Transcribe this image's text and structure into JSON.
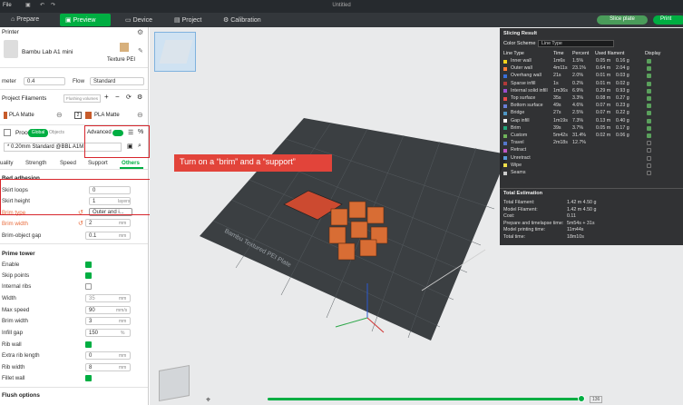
{
  "window": {
    "title": "Untitled",
    "file_menu": "File"
  },
  "tabs": [
    "Prepare",
    "Preview",
    "Device",
    "Project",
    "Calibration"
  ],
  "actions": {
    "slice_plate": "Slice plate",
    "print": "Print"
  },
  "printer": {
    "section": "Printer",
    "name": "Bambu Lab A1 mini",
    "plate": "Texture PEI"
  },
  "nozzle": {
    "diameter_label": "meter",
    "diameter": "0.4",
    "flow_label": "Flow",
    "flow": "Standard"
  },
  "filaments": {
    "section": "Project Filaments",
    "flushing": "Flushing volumes",
    "items": [
      {
        "num": "1",
        "name": "PLA Matte"
      },
      {
        "num": "2",
        "name": "PLA Matte"
      }
    ]
  },
  "process": {
    "section": "Process",
    "global": "Global",
    "objects": "Objects",
    "advanced": "Advanced",
    "profile": "* 0.20mm Standard @BBL A1M"
  },
  "process_tabs": [
    "uality",
    "Strength",
    "Speed",
    "Support",
    "Others"
  ],
  "bed_adhesion": {
    "section": "Bed adhesion",
    "skirt_loops": {
      "label": "Skirt loops",
      "value": "0"
    },
    "skirt_height": {
      "label": "Skirt height",
      "value": "1",
      "unit": "layers"
    },
    "brim_type": {
      "label": "Brim type",
      "value": "Outer and i..."
    },
    "brim_width": {
      "label": "Brim width",
      "value": "2",
      "unit": "mm"
    },
    "brim_gap": {
      "label": "Brim-object gap",
      "value": "0.1",
      "unit": "mm"
    }
  },
  "prime_tower": {
    "section": "Prime tower",
    "enable": "Enable",
    "skip_points": "Skip points",
    "internal_ribs": "Internal ribs",
    "width": {
      "label": "Width",
      "value": "35",
      "unit": "mm"
    },
    "max_speed": {
      "label": "Max speed",
      "value": "90",
      "unit": "mm/s"
    },
    "brim_width": {
      "label": "Brim width",
      "value": "3",
      "unit": "mm"
    },
    "infill_gap": {
      "label": "Infill gap",
      "value": "150",
      "unit": "%"
    },
    "rib_wall": "Rib wall",
    "extra_rib_length": {
      "label": "Extra rib length",
      "value": "0",
      "unit": "mm"
    },
    "rib_width": {
      "label": "Rib width",
      "value": "8",
      "unit": "mm"
    },
    "fillet_wall": "Fillet wall"
  },
  "flush_options": {
    "section": "Flush options"
  },
  "callout": "Turn on a “brim” and a “support”",
  "plate_label": "Bambu Textured PEI Plate",
  "slicing": {
    "title": "Slicing Result",
    "scheme_label": "Color Scheme",
    "scheme": "Line Type",
    "cols": [
      "Line Type",
      "Time",
      "Percent",
      "Used filament",
      "Display"
    ],
    "rows": [
      {
        "name": "Inner wall",
        "time": "1m6s",
        "pct": "1.5%",
        "len": "0.05 m",
        "wt": "0.16 g",
        "color": "#f2d21b",
        "check": true
      },
      {
        "name": "Outer wall",
        "time": "4m11s",
        "pct": "23.1%",
        "len": "0.64 m",
        "wt": "2.04 g",
        "color": "#ff7d38",
        "check": true
      },
      {
        "name": "Overhang wall",
        "time": "21s",
        "pct": "2.0%",
        "len": "0.01 m",
        "wt": "0.03 g",
        "color": "#3a6fd8",
        "check": true
      },
      {
        "name": "Sparse infill",
        "time": "1s",
        "pct": "0.2%",
        "len": "0.01 m",
        "wt": "0.02 g",
        "color": "#b13a3a",
        "check": true
      },
      {
        "name": "Internal solid infill",
        "time": "1m36s",
        "pct": "6.9%",
        "len": "0.29 m",
        "wt": "0.93 g",
        "color": "#9a4fcf",
        "check": true
      },
      {
        "name": "Top surface",
        "time": "35s",
        "pct": "3.3%",
        "len": "0.08 m",
        "wt": "0.27 g",
        "color": "#e84a4a",
        "check": true
      },
      {
        "name": "Bottom surface",
        "time": "49s",
        "pct": "4.6%",
        "len": "0.07 m",
        "wt": "0.23 g",
        "color": "#6a7fd6",
        "check": true
      },
      {
        "name": "Bridge",
        "time": "27s",
        "pct": "2.5%",
        "len": "0.07 m",
        "wt": "0.22 g",
        "color": "#4f96c4",
        "check": true
      },
      {
        "name": "Gap infill",
        "time": "1m19s",
        "pct": "7.3%",
        "len": "0.13 m",
        "wt": "0.40 g",
        "color": "#ffffff",
        "check": true
      },
      {
        "name": "Brim",
        "time": "39s",
        "pct": "3.7%",
        "len": "0.05 m",
        "wt": "0.17 g",
        "color": "#22a67a",
        "check": true
      },
      {
        "name": "Custom",
        "time": "5m42s",
        "pct": "31.4%",
        "len": "0.02 m",
        "wt": "0.06 g",
        "color": "#6fb35a",
        "check": true
      },
      {
        "name": "Travel",
        "time": "2m18s",
        "pct": "12.7%",
        "len": "",
        "wt": "",
        "color": "#5577cc",
        "check": false
      },
      {
        "name": "Retract",
        "time": "",
        "pct": "",
        "len": "",
        "wt": "",
        "color": "#c257c2",
        "check": false
      },
      {
        "name": "Unretract",
        "time": "",
        "pct": "",
        "len": "",
        "wt": "",
        "color": "#5a9ad8",
        "check": false
      },
      {
        "name": "Wipe",
        "time": "",
        "pct": "",
        "len": "",
        "wt": "",
        "color": "#f0e04a",
        "check": false
      },
      {
        "name": "Seams",
        "time": "",
        "pct": "",
        "len": "",
        "wt": "",
        "color": "#cccccc",
        "check": false
      }
    ],
    "estimation": {
      "title": "Total Estimation",
      "rows": [
        {
          "k": "Total Filament:",
          "v": "1.42 m    4.50 g"
        },
        {
          "k": "Model Filament:",
          "v": "1.42 m    4.50 g"
        },
        {
          "k": "Cost:",
          "v": "0.11"
        },
        {
          "k": "Prepare and timelapse time:",
          "v": "5m54s + 31s"
        },
        {
          "k": "Model printing time:",
          "v": "11m44s"
        },
        {
          "k": "Total time:",
          "v": "18m10s"
        }
      ]
    }
  },
  "layer_slider": {
    "max": "136"
  },
  "colors": {
    "accent": "#00ae42",
    "callout": "#e2443a",
    "highlight": "#d7262c"
  }
}
